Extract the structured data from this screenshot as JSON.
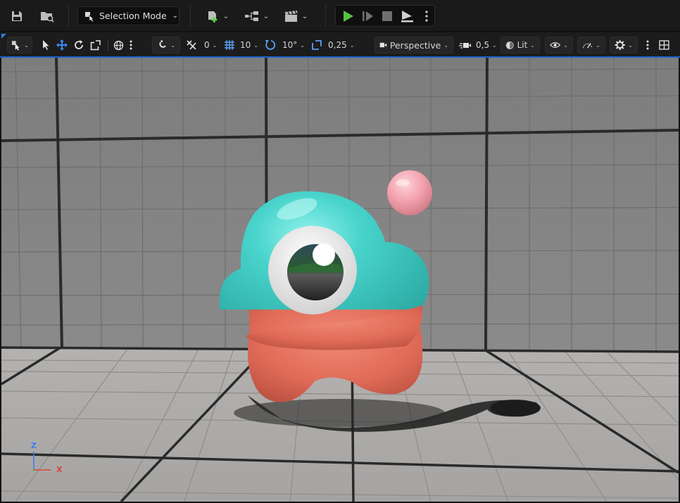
{
  "toolbar": {
    "save_icon": "save-icon",
    "content_browser_icon": "content-browser-icon",
    "mode_label": "Selection Mode",
    "mode_icon": "selection-mode-icon",
    "add_actor_icon": "add-actor-icon",
    "blueprint_icon": "blueprint-icon",
    "cinematics_icon": "clapperboard-icon",
    "play_icon": "play-icon",
    "step_icon": "step-forward-icon",
    "stop_icon": "stop-icon",
    "eject_icon": "eject-icon"
  },
  "viewport_toolbar": {
    "grid_snap_value": "0",
    "location_snap_value": "10",
    "rotation_snap_value": "10°",
    "scale_snap_value": "0,25",
    "view_mode_label": "Perspective",
    "camera_speed_value": "0,5",
    "lighting_mode_label": "Lit"
  },
  "gizmo": {
    "z_label": "Z",
    "x_label": "X"
  },
  "colors": {
    "accent": "#1c62c9",
    "play_green": "#57c041",
    "creature_teal": "#3cc9c1",
    "creature_coral": "#e46f5d",
    "ball_pink": "#f2a0ad"
  }
}
